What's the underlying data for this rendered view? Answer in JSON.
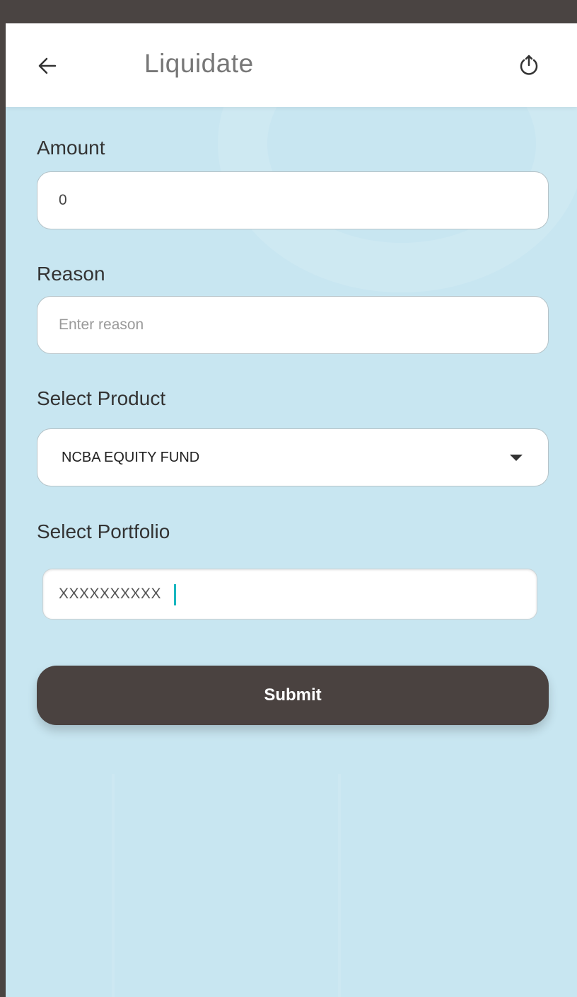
{
  "appbar": {
    "title": "Liquidate",
    "back_icon": "arrow-left-icon",
    "power_icon": "power-icon"
  },
  "form": {
    "amount": {
      "label": "Amount",
      "value": "0"
    },
    "reason": {
      "label": "Reason",
      "placeholder": "Enter reason",
      "value": ""
    },
    "product": {
      "label": "Select Product",
      "selected": "NCBA EQUITY FUND"
    },
    "portfolio": {
      "label": "Select Portfolio",
      "value": "XXXXXXXXXX"
    }
  },
  "submit_label": "Submit",
  "colors": {
    "background": "#c8e6f1",
    "appbar": "#ffffff",
    "button": "#4a4240",
    "cursor": "#19b6c0"
  }
}
